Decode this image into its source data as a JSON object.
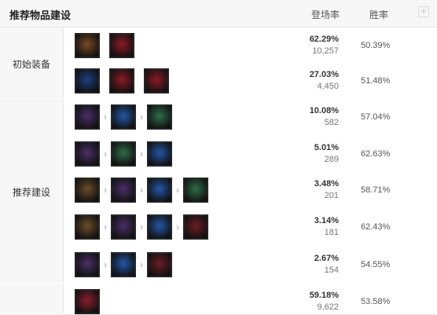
{
  "header": {
    "title": "推荐物品建设",
    "col_pick": "登场率",
    "col_win": "胜率",
    "plus": "+"
  },
  "groups": [
    {
      "label": "初始装备"
    },
    {
      "label": "推荐建设"
    }
  ],
  "rows": [
    {
      "items": [
        "shield-icon",
        "red-potion-icon"
      ],
      "pick_pct": "62.29%",
      "pick_count": "10,257",
      "win": "50.39%"
    },
    {
      "items": [
        "relic-icon",
        "red-potion-icon",
        "red-potion-icon"
      ],
      "pick_pct": "27.03%",
      "pick_count": "4,450",
      "win": "51.48%"
    },
    {
      "items": [
        "purple-helm-icon",
        "hourglass-icon",
        "armor-icon"
      ],
      "pick_pct": "10.08%",
      "pick_count": "582",
      "win": "57.04%"
    },
    {
      "items": [
        "purple-helm-icon",
        "armor-icon",
        "hourglass-icon"
      ],
      "pick_pct": "5.01%",
      "pick_count": "289",
      "win": "62.63%"
    },
    {
      "items": [
        "bronze-helm-icon",
        "purple-helm-icon",
        "hourglass-icon",
        "armor-icon"
      ],
      "pick_pct": "3.48%",
      "pick_count": "201",
      "win": "58.71%"
    },
    {
      "items": [
        "bronze-helm-icon",
        "purple-helm-icon",
        "hourglass-icon",
        "red-armor-icon"
      ],
      "pick_pct": "3.14%",
      "pick_count": "181",
      "win": "62.43%"
    },
    {
      "items": [
        "purple-helm-icon",
        "hourglass-icon",
        "red-armor-icon"
      ],
      "pick_pct": "2.67%",
      "pick_count": "154",
      "win": "54.55%"
    },
    {
      "items": [
        "boots-icon"
      ],
      "pick_pct": "59.18%",
      "pick_count": "9,622",
      "win": "53.58%"
    }
  ],
  "icon_styles": {
    "shield-icon": "#7a4a24",
    "red-potion-icon": "#8b1b24",
    "relic-icon": "#1d3f82",
    "purple-helm-icon": "#4b2f69",
    "hourglass-icon": "#2357a7",
    "armor-icon": "#2f6d48",
    "bronze-helm-icon": "#6a4d2b",
    "red-armor-icon": "#6a1d24",
    "boots-icon": "#8d1f2c"
  }
}
